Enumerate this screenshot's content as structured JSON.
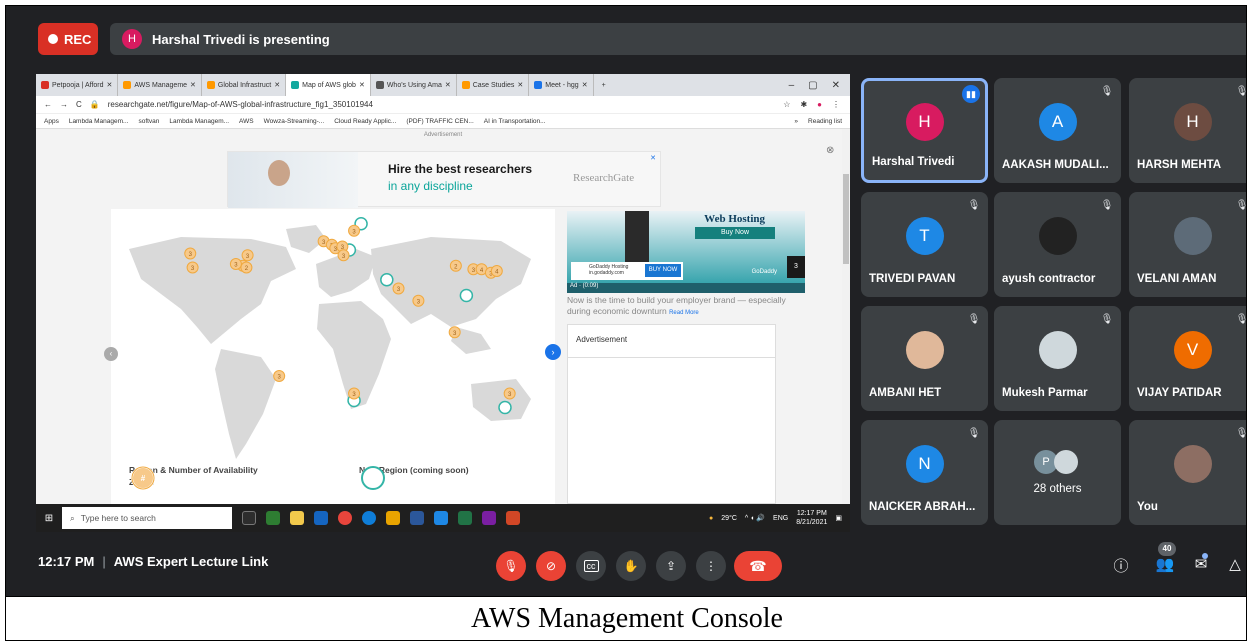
{
  "meet": {
    "rec_label": "REC",
    "presenter_initial": "H",
    "presenting_text": "Harshal Trivedi is presenting",
    "time": "12:17 PM",
    "separator": "|",
    "meeting_title": "AWS Expert Lecture Link",
    "people_count": "40"
  },
  "caption": "AWS Management Console",
  "browser": {
    "tabs": [
      {
        "label": "Petpooja | Afford",
        "color": "#d93025"
      },
      {
        "label": "AWS Manageme",
        "color": "#ff9900"
      },
      {
        "label": "Global Infrastruct",
        "color": "#ff9900"
      },
      {
        "label": "Map of AWS glob",
        "color": "#13a89e"
      },
      {
        "label": "Who's Using Ama",
        "color": "#555555"
      },
      {
        "label": "Case Studies",
        "color": "#ff9900"
      },
      {
        "label": "Meet - hgg",
        "color": "#1a73e8"
      }
    ],
    "new_tab": "+",
    "url": "researchgate.net/figure/Map-of-AWS-global-infrastructure_fig1_350101944",
    "bookmarks": [
      "Apps",
      "Lambda Managem...",
      "softvan",
      "Lambda Managem...",
      "AWS",
      "Wowza-Streaming-...",
      "Cloud Ready Applic...",
      "(PDF) TRAFFIC CEN...",
      "AI in Transportation..."
    ],
    "reading_list": "Reading list",
    "chevron": "»"
  },
  "page": {
    "advertisement_label": "Advertisement",
    "ad_headline": "Hire the best researchers",
    "ad_subline": "in any discipline",
    "ad_brand": "ResearchGate",
    "side_ad_title": "Web Hosting",
    "side_ad_buy": "Buy Now",
    "godaddy_line1": "GoDaddy Hosting",
    "godaddy_line2": "in.godaddy.com",
    "godaddy_buy": "BUY NOW",
    "godaddy_brand": "GoDaddy",
    "side_ad_num": "3",
    "ad_timer": "Ad · (0:09)",
    "employer_text": "Now is the time to build your employer brand — especially during economic downturn",
    "read_more": "Read More",
    "advertisement_box": "Advertisement",
    "legend_region": "Region & Number of Availability Zones",
    "legend_new": "New Region (coming soon)",
    "map_regions": [
      {
        "label": "3",
        "lon": -122,
        "lat": 46
      },
      {
        "label": "3",
        "lon": -120,
        "lat": 38
      },
      {
        "label": "2",
        "lon": -77,
        "lat": 39
      },
      {
        "label": "3",
        "lon": -83,
        "lat": 40
      },
      {
        "label": "3",
        "lon": -73,
        "lat": 45
      },
      {
        "label": "2",
        "lon": -74,
        "lat": 38
      },
      {
        "label": "3",
        "lon": -8,
        "lat": 53
      },
      {
        "label": "3",
        "lon": -1,
        "lat": 51
      },
      {
        "label": "3",
        "lon": 2,
        "lat": 49
      },
      {
        "label": "3",
        "lon": 8,
        "lat": 50
      },
      {
        "label": "3",
        "lon": 18,
        "lat": 59
      },
      {
        "label": "3",
        "lon": 9,
        "lat": 45
      },
      {
        "label": "3",
        "lon": 56,
        "lat": 26
      },
      {
        "label": "3",
        "lon": 73,
        "lat": 19
      },
      {
        "label": "3",
        "lon": 104,
        "lat": 1
      },
      {
        "label": "2",
        "lon": 105,
        "lat": 39
      },
      {
        "label": "3",
        "lon": 120,
        "lat": 37
      },
      {
        "label": "4",
        "lon": 127,
        "lat": 37
      },
      {
        "label": "3",
        "lon": 135,
        "lat": 35
      },
      {
        "label": "4",
        "lon": 140,
        "lat": 36
      },
      {
        "label": "3",
        "lon": 151,
        "lat": -34
      },
      {
        "label": "3",
        "lon": -46,
        "lat": -24
      },
      {
        "label": "3",
        "lon": 18,
        "lat": -34
      }
    ],
    "map_new_regions": [
      {
        "lon": 24,
        "lat": 63
      },
      {
        "lon": 14,
        "lat": 48
      },
      {
        "lon": 46,
        "lat": 31
      },
      {
        "lon": 114,
        "lat": 22
      },
      {
        "lon": 147,
        "lat": -42
      },
      {
        "lon": 18,
        "lat": -38
      }
    ]
  },
  "taskbar": {
    "search_placeholder": "Type here to search",
    "weather": "29°C",
    "lang": "ENG",
    "clock_time": "12:17 PM",
    "clock_date": "8/21/2021"
  },
  "participants": [
    {
      "name": "Harshal Trivedi",
      "initial": "H",
      "color": "#d81b60",
      "speaking": true
    },
    {
      "name": "AAKASH MUDALI...",
      "initial": "A",
      "color": "#1e88e5"
    },
    {
      "name": "HARSH MEHTA",
      "initial": "H",
      "color": "#6d4c41"
    },
    {
      "name": "TRIVEDI PAVAN",
      "initial": "T",
      "color": "#1e88e5"
    },
    {
      "name": "ayush contractor",
      "initial": "",
      "color": "#222222"
    },
    {
      "name": "VELANI AMAN",
      "initial": "",
      "color": "#5d6b78"
    },
    {
      "name": "AMBANI HET",
      "initial": "",
      "color": "#e0b89a"
    },
    {
      "name": "Mukesh Parmar",
      "initial": "",
      "color": "#cfd8dc"
    },
    {
      "name": "VIJAY PATIDAR",
      "initial": "V",
      "color": "#ef6c00"
    },
    {
      "name": "NAICKER ABRAH...",
      "initial": "N",
      "color": "#1e88e5"
    },
    {
      "name": "28 others",
      "initial": "P",
      "color": "#78909c"
    },
    {
      "name": "You",
      "initial": "",
      "color": "#8d6e63"
    }
  ]
}
